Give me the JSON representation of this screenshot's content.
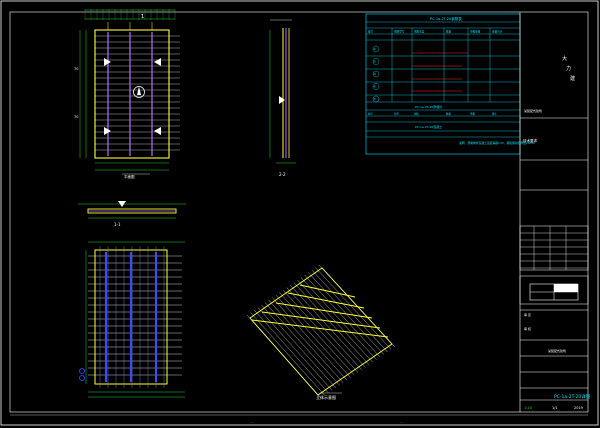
{
  "plan_view": {
    "top_dim": "1",
    "label": "平面图",
    "side_dims": [
      "70",
      "70"
    ]
  },
  "section_22": {
    "label": "2-2"
  },
  "section_11": {
    "label": "1-1"
  },
  "iso_view": {
    "label": "立体示意图"
  },
  "rebar_table": {
    "title": "PC-1a-2T-20钢筋表",
    "headers": [
      "编号",
      "钢筋型号",
      "钢筋长度",
      "数量",
      "单根重量",
      "重量合计"
    ],
    "rows": [
      [
        "①",
        "",
        "",
        "",
        "",
        ""
      ],
      [
        "②",
        "",
        "",
        "",
        "",
        ""
      ],
      [
        "③",
        "",
        "",
        "",
        "",
        ""
      ],
      [
        "④",
        "",
        "",
        "",
        "",
        ""
      ],
      [
        "⑤",
        "",
        "",
        "",
        "",
        ""
      ]
    ],
    "embed_title": "PC-1a-2T-20预埋件",
    "embed_headers": [
      "编号",
      "名称",
      "规格",
      "数量",
      "单重",
      "备注"
    ],
    "embed_rows": [
      [
        "",
        "",
        "",
        "",
        "",
        ""
      ],
      [
        "",
        "",
        "",
        "",
        "",
        ""
      ]
    ],
    "conc_title": "PC-1a-2T-20混凝土",
    "note": "说明：预制构件混凝土强度等级C30，钢筋保护层厚度20mm"
  },
  "tech_note": "技术要求",
  "title_block": {
    "company": [
      "大",
      "力",
      "建",
      "筑"
    ],
    "project": "某装配式建筑",
    "drawing_no": "PC-1a-2T-20详图",
    "scale": "1:20",
    "sheet": "1/1",
    "page": "2019",
    "rows": [
      "审 定",
      "审 核",
      "校 对",
      "设 计",
      "制 图"
    ]
  },
  "colors": {
    "background": "#000000",
    "frame": "#ffffff",
    "table": "#00e5ff",
    "rebar_yellow": "#ffff33",
    "rebar_purple": "#b070ff",
    "rebar_blue": "#3b4cff",
    "dimension": "#21d13b",
    "emphasis_red": "#ff2b2b"
  }
}
